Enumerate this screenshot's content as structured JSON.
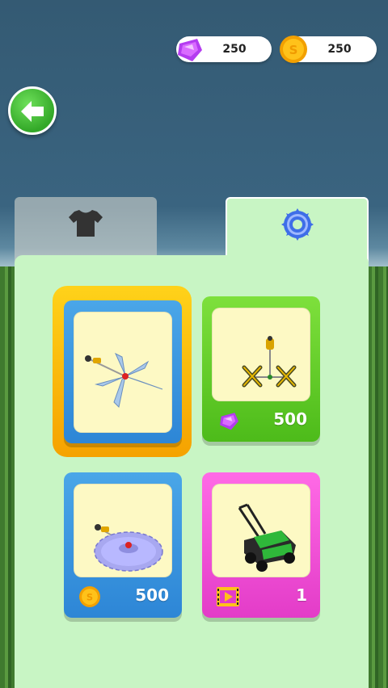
{
  "currencies": {
    "gems": "250",
    "coins": "250",
    "gem_icon": "purple-gem-icon",
    "coin_icon": "gold-coin-icon"
  },
  "header": {
    "back_icon": "back-arrow-icon"
  },
  "tabs": [
    {
      "icon": "t-shirt-icon",
      "selected": false
    },
    {
      "icon": "saw-blade-icon",
      "selected": true
    }
  ],
  "items": [
    {
      "item": "propeller-trimmer",
      "price": "",
      "currency": "",
      "selected": true
    },
    {
      "item": "double-blade-trimmer",
      "price": "500",
      "currency": "gem"
    },
    {
      "item": "circular-saw-trimmer",
      "price": "500",
      "currency": "coin"
    },
    {
      "item": "lawn-mower",
      "price": "1",
      "currency": "video-ad"
    }
  ],
  "colors": {
    "sky": "#3a6480",
    "panel": "#c8f5c4",
    "card_blue": "#2d86d6",
    "card_green": "#4dbb1a",
    "card_pink": "#e33cc8",
    "selected_frame": "#f5a200"
  }
}
